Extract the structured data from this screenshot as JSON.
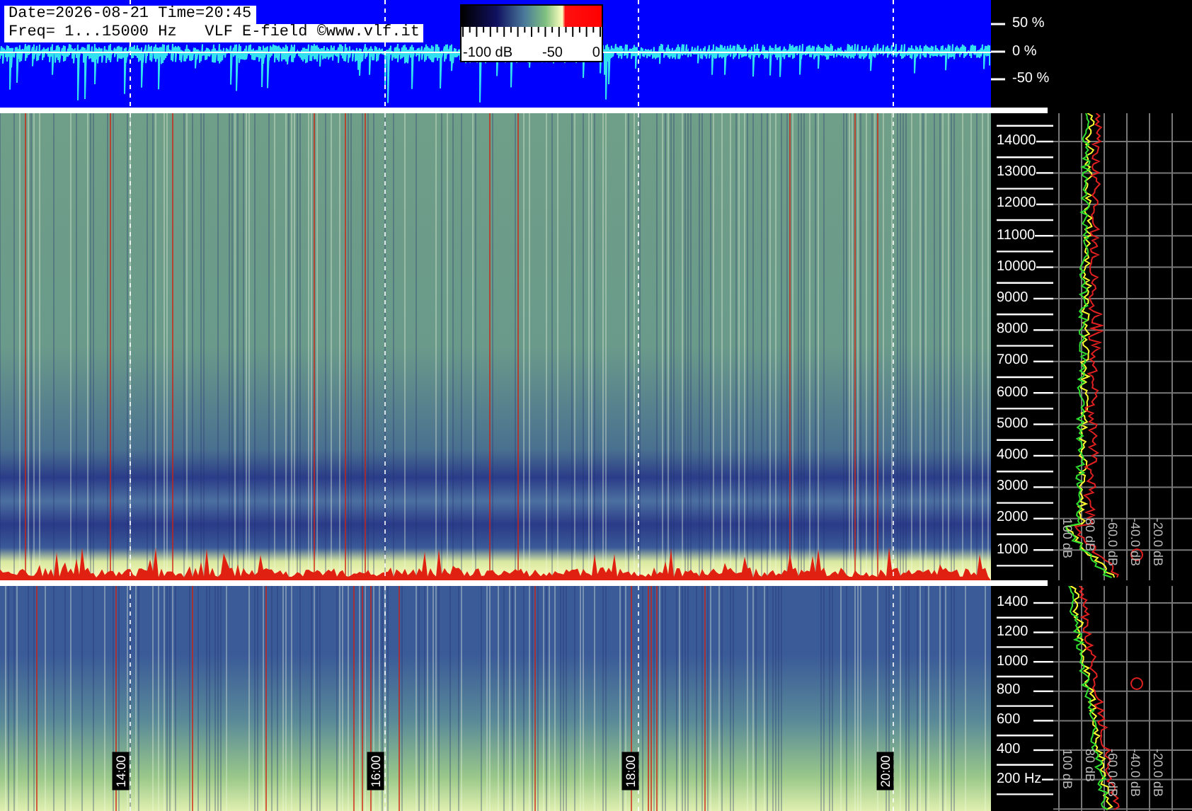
{
  "header": {
    "date_time": "Date=2026-08-21 Time=20:45",
    "frequency_info": "Freq= 1...15000 Hz   VLF E-field ©www.vlf.it"
  },
  "color_scale": {
    "labels": [
      "-100 dB",
      "-50",
      "0"
    ]
  },
  "waveform_axis": {
    "labels": [
      "50 %",
      "0 %",
      "-50 %"
    ]
  },
  "upper_panel": {
    "frequency_labels": [
      "14000",
      "13000",
      "12000",
      "11000",
      "10000",
      "9000",
      "8000",
      "7000",
      "6000",
      "5000",
      "4000",
      "3000",
      "2000",
      "1000"
    ],
    "db_labels": [
      "100 dB",
      "80 dB",
      "-60.0 dB",
      "-40.0 dB",
      "-20.0 dB"
    ]
  },
  "lower_panel": {
    "frequency_labels": [
      "1400",
      "1200",
      "1000",
      "800",
      "600",
      "400",
      "200 Hz"
    ],
    "db_labels": [
      "100 dB",
      "80 dB",
      "-60.0 dB",
      "-40.0 dB",
      "-20.0 dB"
    ]
  },
  "time_labels": [
    "14:00",
    "16:00",
    "18:00",
    "20:00"
  ]
}
